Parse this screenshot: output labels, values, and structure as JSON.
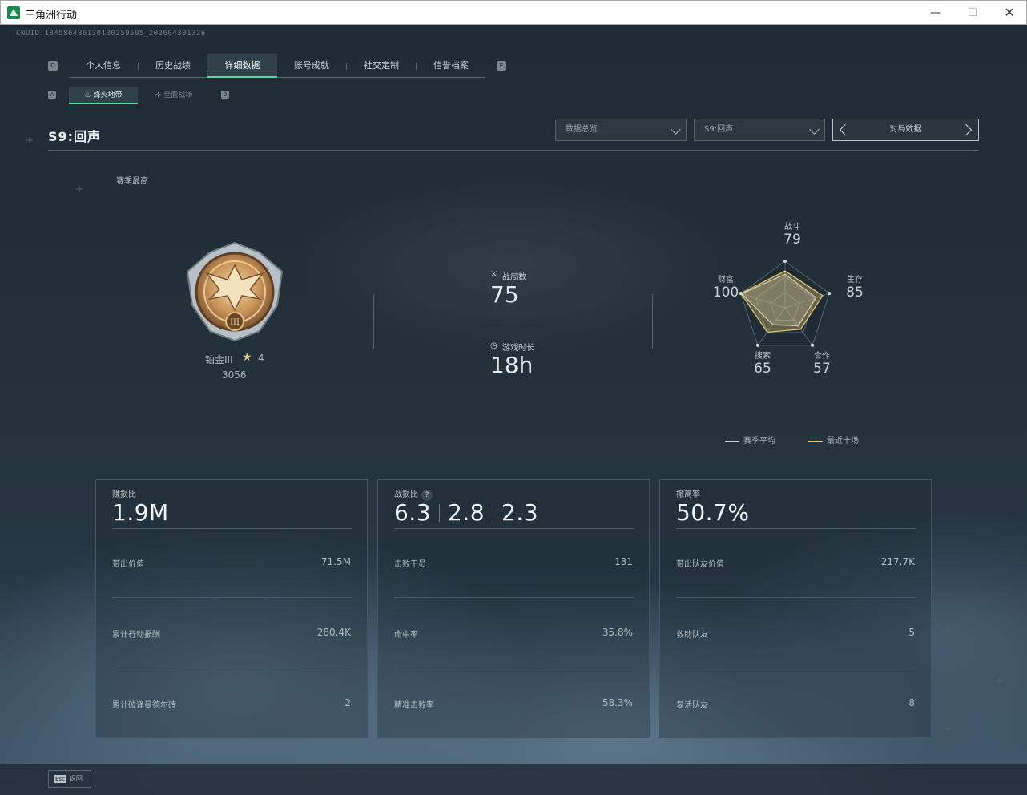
{
  "window": {
    "title": "三角洲行动",
    "minimize": "—",
    "maximize": "☐",
    "close": "✕"
  },
  "header": {
    "cnuid": "CNUID:18458648613013025959​5_202604301326"
  },
  "nav": {
    "prev_key": "Q",
    "next_key": "E",
    "tabs": [
      {
        "label": "个人信息"
      },
      {
        "label": "历史战绩"
      },
      {
        "label": "详细数据"
      },
      {
        "label": "账号成就"
      },
      {
        "label": "社交定制"
      },
      {
        "label": "信誉档案"
      }
    ],
    "active_index": 2
  },
  "subnav": {
    "prev_key": "A",
    "next_key": "D",
    "tabs": [
      {
        "label": "烽火地带",
        "icon": "flame-icon"
      },
      {
        "label": "全面战场",
        "icon": "crosshair-icon"
      }
    ],
    "active_index": 0
  },
  "season": {
    "title": "S9:回声",
    "best_label": "赛季最高"
  },
  "filters": {
    "overview": "数据总览",
    "season": "S9:回声",
    "pager_label": "对局数据"
  },
  "rank": {
    "name": "铂金III",
    "star_glyph": "★",
    "stars": "4",
    "score": "3056"
  },
  "summary": {
    "matches_label": "战局数",
    "matches_value": "75",
    "playtime_label": "游戏时长",
    "playtime_value": "18h"
  },
  "radar": {
    "axes": [
      {
        "label": "战斗",
        "value": "79"
      },
      {
        "label": "生存",
        "value": "85"
      },
      {
        "label": "合作",
        "value": "57"
      },
      {
        "label": "搜索",
        "value": "65"
      },
      {
        "label": "财富",
        "value": "100"
      }
    ],
    "season_avg": [
      72,
      70,
      48,
      45,
      98
    ],
    "recent_ten": [
      79,
      85,
      57,
      65,
      100
    ],
    "colors": {
      "season_avg": "#c8d0d4",
      "recent_ten": "#e2c56d"
    }
  },
  "legend": {
    "season_avg": "赛季平均",
    "recent_ten": "最近十场"
  },
  "cards": [
    {
      "label": "赚损比",
      "big": [
        "1.9M"
      ],
      "rows": [
        {
          "label": "带出价值",
          "value": "71.5M"
        },
        {
          "label": "累计行动报酬",
          "value": "280.4K"
        },
        {
          "label": "累计破译曼德尔砖",
          "value": "2"
        }
      ]
    },
    {
      "label": "战损比",
      "help": "?",
      "big": [
        "6.3",
        "2.8",
        "2.3"
      ],
      "rows": [
        {
          "label": "击败干员",
          "value": "131"
        },
        {
          "label": "命中率",
          "value": "35.8%"
        },
        {
          "label": "精准击败率",
          "value": "58.3%"
        }
      ]
    },
    {
      "label": "撤离率",
      "big": [
        "50.7%"
      ],
      "rows": [
        {
          "label": "带出队友价值",
          "value": "217.7K"
        },
        {
          "label": "救助队友",
          "value": "5"
        },
        {
          "label": "复活队友",
          "value": "8"
        }
      ]
    }
  ],
  "footer": {
    "esc_key": "Esc",
    "esc_label": "返回"
  }
}
